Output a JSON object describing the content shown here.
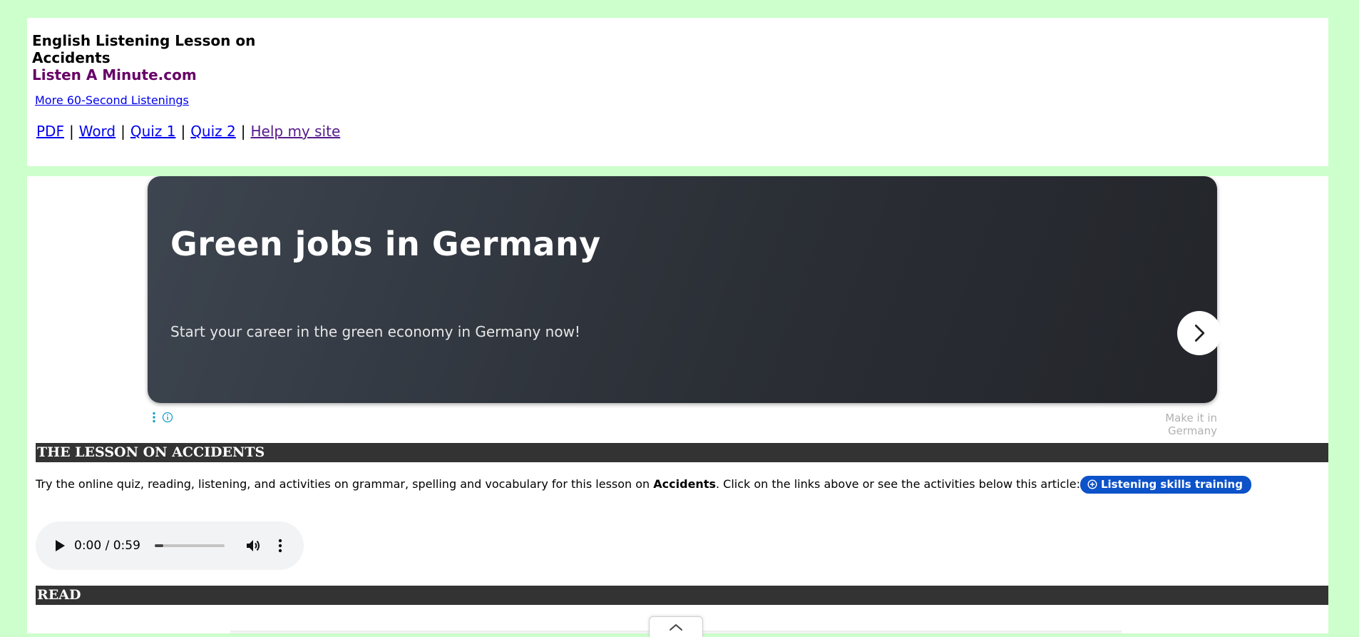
{
  "header": {
    "title": "English Listening Lesson on Accidents",
    "brand": "Listen A Minute.com",
    "more_link": "More 60-Second Listenings",
    "nav": [
      {
        "label": "PDF"
      },
      {
        "label": "Word"
      },
      {
        "label": "Quiz 1"
      },
      {
        "label": "Quiz 2"
      },
      {
        "label": "Help my site"
      }
    ],
    "separator": "|"
  },
  "ad": {
    "title": "Green jobs in Germany",
    "subtitle": "Start your career in the green economy in Germany now!",
    "source": "Make it in Germany",
    "arrow_icon": "chevron-right-icon",
    "options_icons": [
      "kebab-menu-icon",
      "info-icon"
    ]
  },
  "lesson": {
    "heading": "THE LESSON ON ACCIDENTS",
    "intro_before": "Try the online quiz, reading, listening, and activities on grammar, spelling and vocabulary for this lesson on ",
    "intro_bold": "Accidents",
    "intro_after": ". Click on the links above or see the activities below this article:",
    "pill_label": "Listening skills training",
    "pill_icon": "circle-plus-icon"
  },
  "audio": {
    "time": "0:00 / 0:59",
    "progress": 0.12,
    "icons": [
      "play-icon",
      "volume-icon",
      "more-vert-icon"
    ]
  },
  "read": {
    "heading": "READ"
  },
  "colors": {
    "page_bg": "#ccffcc",
    "brand": "#660066",
    "link": "#0000ee",
    "visited": "#551a8b",
    "section_bar": "#333333",
    "pill": "#0c52c9"
  }
}
